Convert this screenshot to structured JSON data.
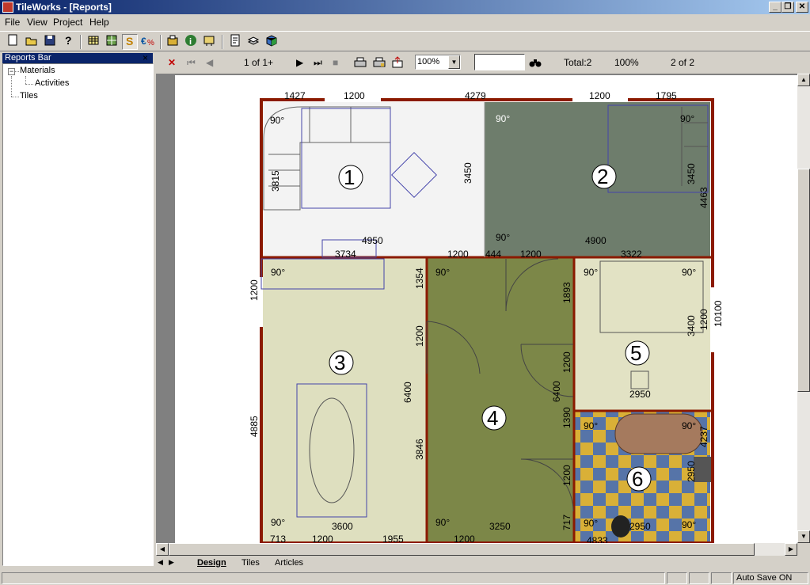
{
  "window": {
    "title": "TileWorks - [Reports]",
    "buttons": [
      "_",
      "❐",
      "✕"
    ]
  },
  "menu": [
    "File",
    "View",
    "Project",
    "Help"
  ],
  "toolbar_icons": [
    "new-icon",
    "open-icon",
    "save-icon",
    "help-icon",
    "grid-icon",
    "tile-icon",
    "materials-icon",
    "currency-icon",
    "settings-icon",
    "info-icon",
    "tools-icon",
    "report-icon",
    "stack-icon",
    "box-icon"
  ],
  "reports_bar": {
    "title": "Reports Bar",
    "close": "×",
    "tree": {
      "materials": "Materials",
      "activities": "Activities",
      "tiles": "Tiles",
      "expander": "−"
    }
  },
  "report_toolbar": {
    "page_indicator": "1 of 1+",
    "zoom": "100%",
    "find_value": "",
    "total": "Total:2",
    "percent": "100%",
    "pages": "2 of 2"
  },
  "tabs": [
    "Design",
    "Tiles",
    "Articles"
  ],
  "status": {
    "autosave": "Auto Save ON"
  },
  "colors": {
    "wall": "#8b1a00",
    "room1": "#f3f3f3",
    "room2": "#6e7d6c",
    "room3": "#dedfbf",
    "room4": "#7c8748",
    "room5": "#e2e2c4",
    "tile_blue": "#5674a8",
    "tile_yellow": "#d9b037"
  },
  "floorplan": {
    "rooms": [
      {
        "number": "1",
        "angle": "90°",
        "dims": [
          "3815",
          "3450",
          "4950"
        ]
      },
      {
        "number": "2",
        "angles": [
          "90°",
          "90°",
          "90°"
        ],
        "dims": [
          "3450",
          "4463",
          "4900"
        ]
      },
      {
        "number": "3",
        "angles": [
          "90°",
          "90°"
        ],
        "dims": [
          "1200",
          "4885",
          "3600",
          "713",
          "1200",
          "1955"
        ]
      },
      {
        "number": "4",
        "angles": [
          "90°",
          "90°"
        ],
        "dims": [
          "1354",
          "1200",
          "6400",
          "3846",
          "6400",
          "1893",
          "1200",
          "1390",
          "1200",
          "717",
          "3250",
          "1200"
        ]
      },
      {
        "number": "5",
        "angles": [
          "90°",
          "90°"
        ],
        "dims": [
          "3400",
          "1200",
          "10100",
          "2950"
        ]
      },
      {
        "number": "6",
        "angles": [
          "90°",
          "90°",
          "90°",
          "90°"
        ],
        "dims": [
          "4237",
          "2950",
          "2950",
          "4833"
        ]
      }
    ],
    "top_dims": [
      "1427",
      "1200",
      "4279",
      "1200",
      "1795"
    ],
    "mid_dims": [
      "3734",
      "1200",
      "444",
      "1200",
      "3322"
    ]
  }
}
